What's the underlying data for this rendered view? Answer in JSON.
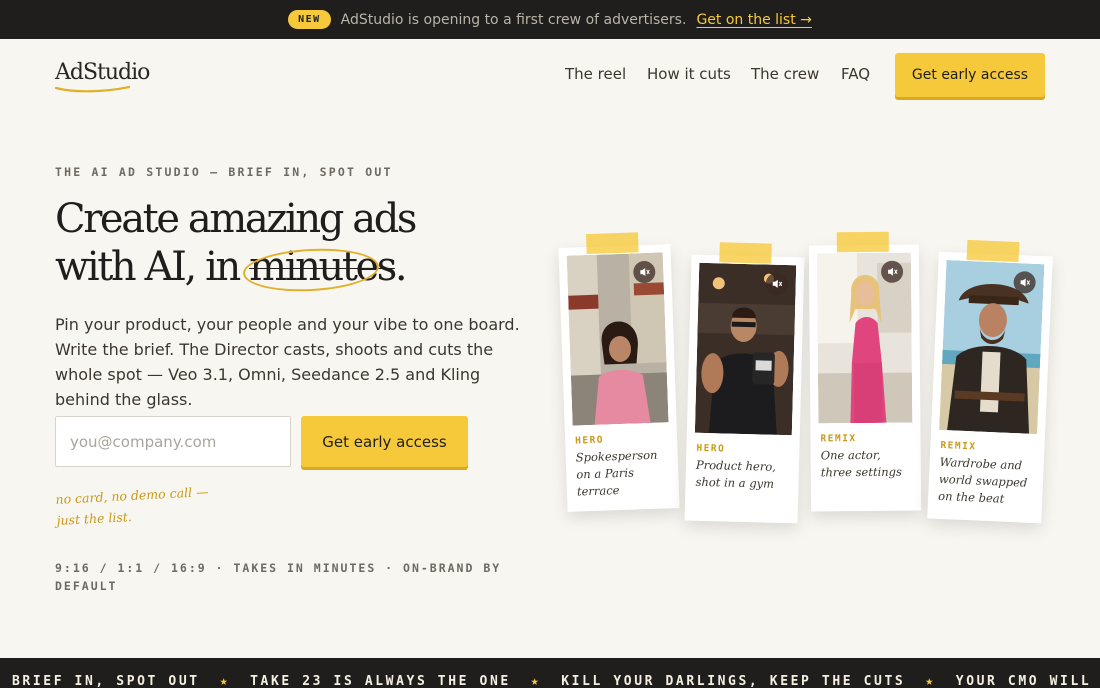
{
  "announcement": {
    "badge": "NEW",
    "text": "AdStudio is opening to a first crew of advertisers.",
    "link": "Get on the list →"
  },
  "header": {
    "logo": "AdStudio",
    "nav": [
      "The reel",
      "How it cuts",
      "The crew",
      "FAQ"
    ],
    "cta": "Get early access"
  },
  "hero": {
    "eyebrow": "THE AI AD STUDIO — BRIEF IN, SPOT OUT",
    "headline_line1": "Create amazing ads",
    "headline_line2_prefix": "with AI, in ",
    "headline_highlight": "minutes",
    "headline_suffix": ".",
    "lede": "Pin your product, your people and your vibe to one board. Write the brief. The Director casts, shoots and cuts the whole spot — Veo 3.1, Omni, Seedance 2.5 and Kling behind the glass.",
    "email_placeholder": "you@company.com",
    "cta": "Get early access",
    "note": "no card, no demo call — just the list.",
    "specs": "9:16 / 1:1 / 16:9  ·  TAKES IN MINUTES  ·  ON-BRAND BY DEFAULT"
  },
  "cards": [
    {
      "tag": "HERO",
      "caption": "Spokesperson on a Paris terrace",
      "icon": "muted-speaker-icon"
    },
    {
      "tag": "HERO",
      "caption": "Product hero, shot in a gym",
      "icon": "muted-speaker-icon"
    },
    {
      "tag": "REMIX",
      "caption": "One actor, three settings",
      "icon": "muted-speaker-icon"
    },
    {
      "tag": "REMIX",
      "caption": "Wardrobe and world swapped on the beat",
      "icon": "muted-speaker-icon"
    }
  ],
  "marquee": {
    "items": [
      "BRIEF IN, SPOT OUT",
      "TAKE 23 IS ALWAYS THE ONE",
      "KILL YOUR DARLINGS, KEEP THE CUTS",
      "YOUR CMO WILL SAY “M"
    ]
  },
  "colors": {
    "accent": "#f6c93a",
    "dark": "#1f1e1c",
    "background": "#f8f6f0"
  }
}
